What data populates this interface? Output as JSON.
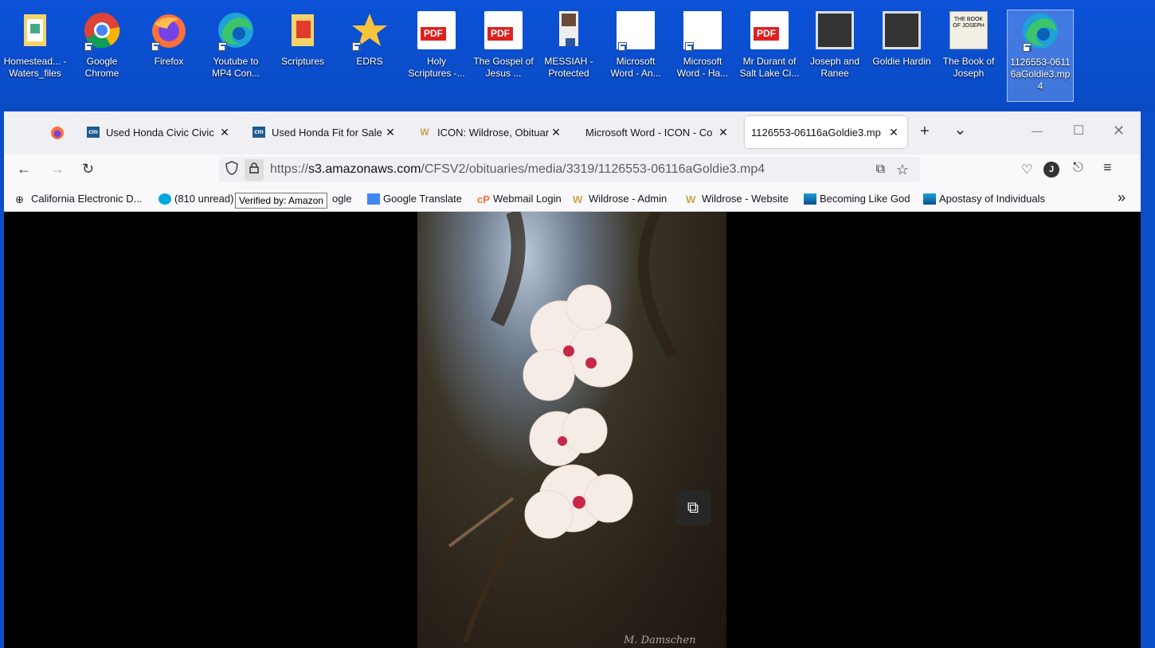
{
  "desktop": {
    "icons": [
      {
        "label": "Homestead... - Waters_files",
        "icon": "folder-icon"
      },
      {
        "label": "Google Chrome",
        "icon": "chrome-icon"
      },
      {
        "label": "Firefox",
        "icon": "firefox-icon"
      },
      {
        "label": "Youtube to MP4 Con...",
        "icon": "edge-icon"
      },
      {
        "label": "Scriptures",
        "icon": "folder-icon"
      },
      {
        "label": "EDRS",
        "icon": "star-icon"
      },
      {
        "label": "Holy Scriptures -...",
        "icon": "pdf-icon",
        "badge": "PDF"
      },
      {
        "label": "The Gospel of Jesus ...",
        "icon": "pdf-icon",
        "badge": "PDF"
      },
      {
        "label": "MESSIAH - Protected",
        "icon": "word-doc-icon"
      },
      {
        "label": "Microsoft Word - An...",
        "icon": "doc-icon"
      },
      {
        "label": "Microsoft Word - Ha...",
        "icon": "doc-icon"
      },
      {
        "label": "Mr Durant of Salt Lake Ci...",
        "icon": "pdf-icon",
        "badge": "PDF"
      },
      {
        "label": "Joseph and Ranee",
        "icon": "photo-icon"
      },
      {
        "label": "Goldie Hardin",
        "icon": "photo-icon"
      },
      {
        "label": "The Book of Joseph",
        "icon": "powerpoint-icon",
        "badge": "THE BOOK OF JOSEPH"
      },
      {
        "label": "1126553-06116aGoldie3.mp4",
        "icon": "edge-icon"
      }
    ]
  },
  "tabs": [
    {
      "label": "Used Honda Civic Civic",
      "favicon": "cm"
    },
    {
      "label": "Used Honda Fit for Sale",
      "favicon": "cm"
    },
    {
      "label": "ICON: Wildrose, Obituar",
      "favicon": "W"
    },
    {
      "label": "Microsoft Word - ICON - Co",
      "favicon": ""
    },
    {
      "label": "1126553-06116aGoldie3.mp",
      "favicon": ""
    }
  ],
  "tab_close": "✕",
  "new_tab": "+",
  "tab_list": "⌄",
  "window": {
    "minimize": "—",
    "maximize": "☐",
    "close": "✕"
  },
  "nav": {
    "back": "←",
    "forward": "→",
    "reload": "↻",
    "url_prefix": "https://",
    "url_host": "s3.amazonaws.com",
    "url_path": "/CFSV2/obituaries/media/3319/1126553-06116aGoldie3.mp4",
    "tooltip": "Verified by: Amazon",
    "avatar": "J"
  },
  "bookmarks": [
    "California Electronic D...",
    "(810 unread)",
    "ogle",
    "Google Translate",
    "Webmail Login",
    "Wildrose - Admin",
    "Wildrose - Website",
    "Becoming Like God",
    "Apostasy of Individuals"
  ],
  "bookmarks_more": "»",
  "video": {
    "watermark": "M. Damschen"
  },
  "colors": {
    "desktop": "#0a4ec9",
    "tabbar": "#f0f0f4",
    "toolbar": "#f9f9fb"
  }
}
